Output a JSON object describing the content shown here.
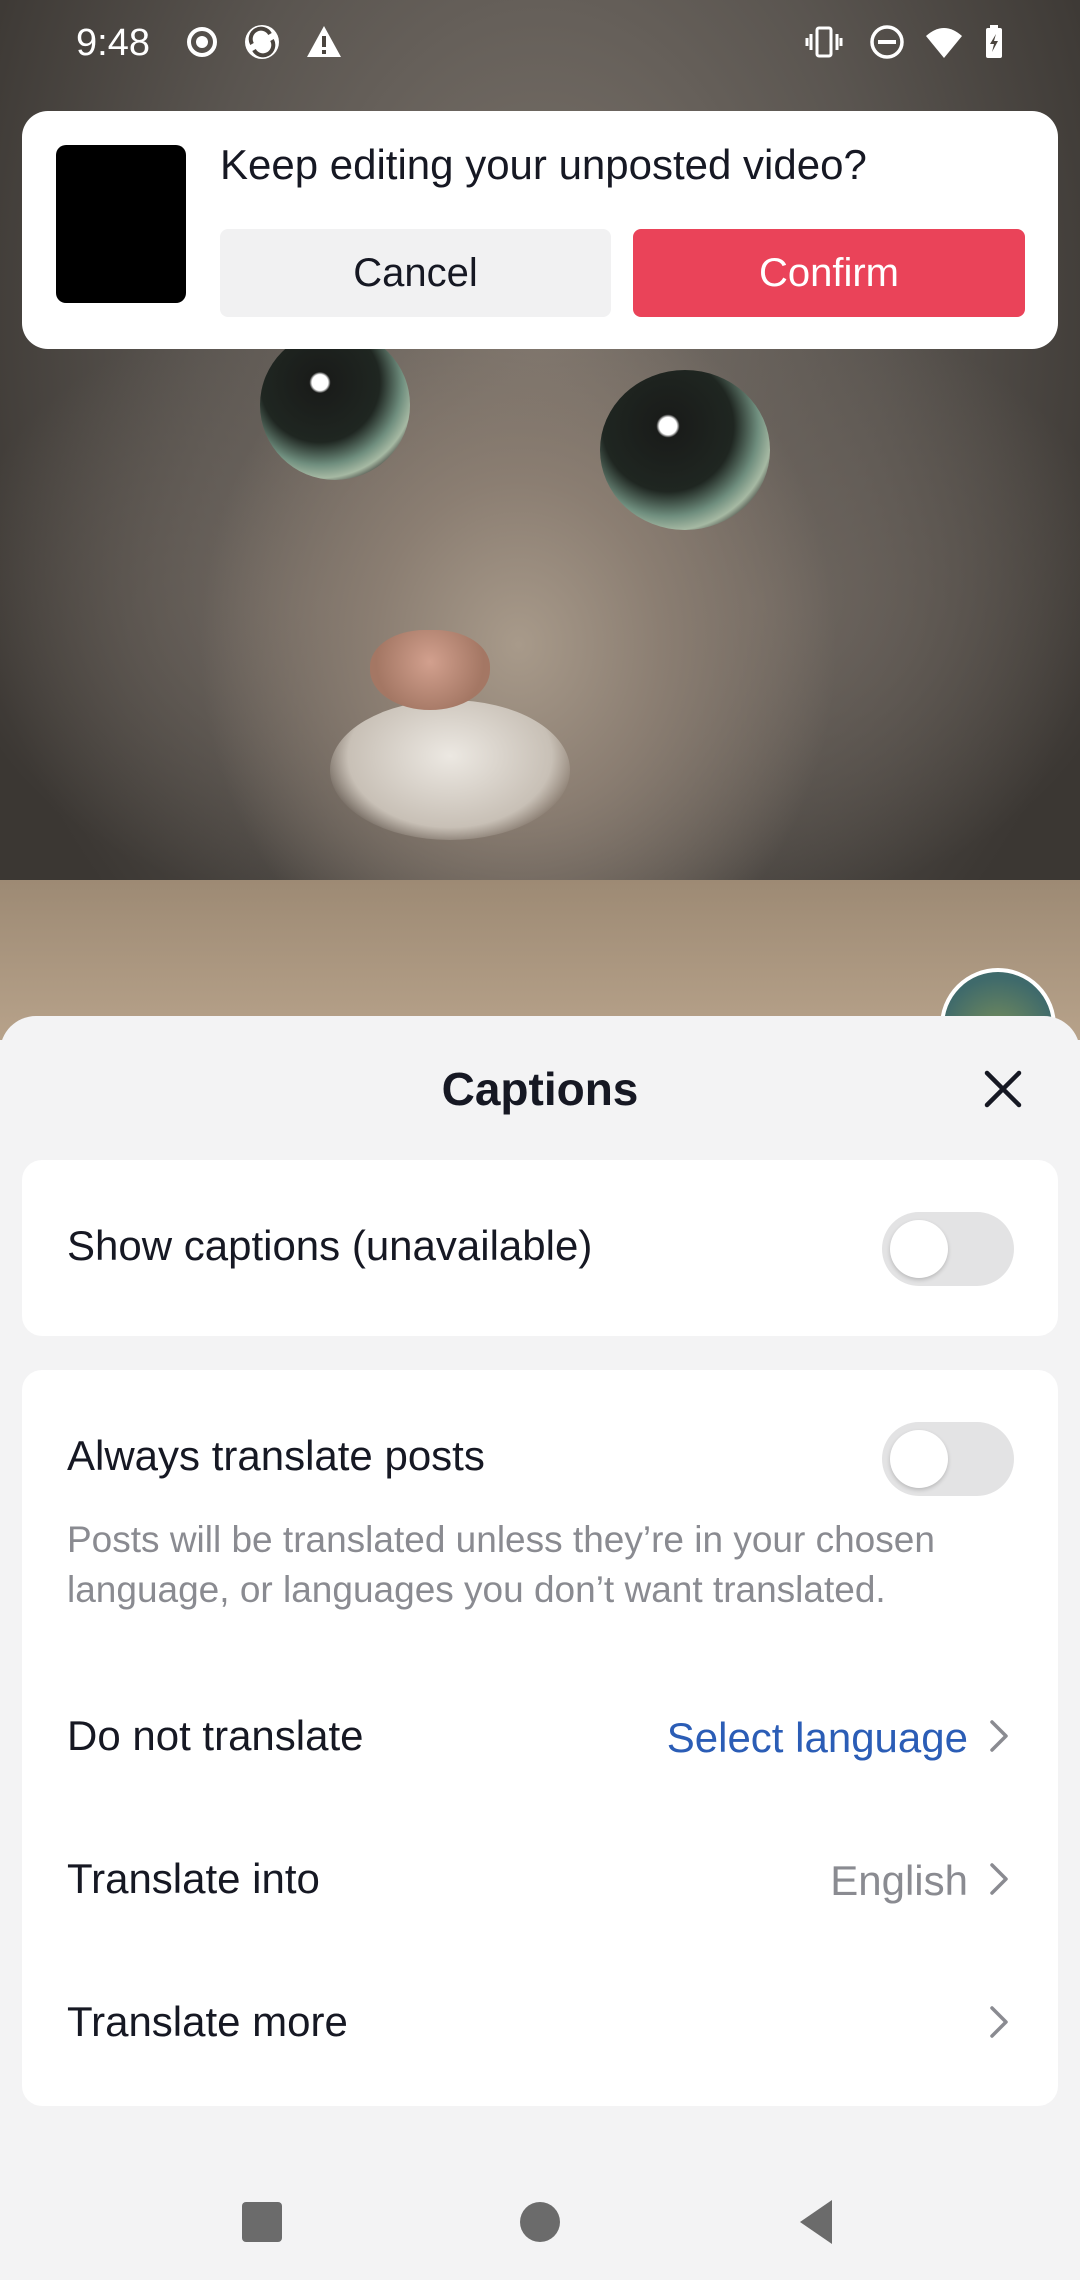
{
  "status_bar": {
    "time": "9:48",
    "icons_left": [
      "record-icon",
      "sync-icon",
      "alert-icon"
    ],
    "icons_right": [
      "vibrate-icon",
      "dnd-icon",
      "wifi-icon",
      "battery-icon"
    ]
  },
  "draft_dialog": {
    "question": "Keep editing your unposted video?",
    "cancel_label": "Cancel",
    "confirm_label": "Confirm"
  },
  "captions_sheet": {
    "title": "Captions",
    "show_captions": {
      "label": "Show captions (unavailable)",
      "enabled": false
    },
    "always_translate": {
      "label": "Always translate posts",
      "enabled": false,
      "description": "Posts will be translated unless they’re in your chosen language, or languages you don’t want translated."
    },
    "do_not_translate": {
      "label": "Do not translate",
      "value": "Select language"
    },
    "translate_into": {
      "label": "Translate into",
      "value": "English"
    },
    "translate_more": {
      "label": "Translate more"
    }
  },
  "colors": {
    "accent_confirm": "#ea4359",
    "link_blue": "#2b5db6",
    "toggle_off": "#e3e3e4",
    "sheet_bg": "#f3f3f4"
  }
}
